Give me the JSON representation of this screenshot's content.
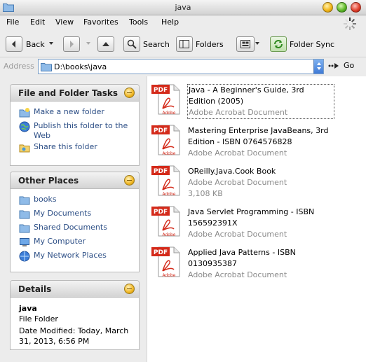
{
  "window": {
    "title": "java"
  },
  "menu": [
    "File",
    "Edit",
    "View",
    "Favorites",
    "Tools",
    "Help"
  ],
  "toolbar": {
    "back_label": "Back",
    "search_label": "Search",
    "folders_label": "Folders",
    "folder_sync_label": "Folder Sync"
  },
  "address": {
    "label": "Address",
    "value": "D:\\books\\java",
    "go_label": "Go"
  },
  "sidebar": {
    "tasks": {
      "title": "File and Folder Tasks",
      "items": [
        {
          "label": "Make a new folder",
          "icon": "new-folder-icon"
        },
        {
          "label": "Publish this folder to the Web",
          "icon": "globe-icon"
        },
        {
          "label": "Share this folder",
          "icon": "share-folder-icon"
        }
      ]
    },
    "places": {
      "title": "Other Places",
      "items": [
        {
          "label": "books",
          "icon": "folder-icon"
        },
        {
          "label": "My Documents",
          "icon": "folder-icon"
        },
        {
          "label": "Shared Documents",
          "icon": "folder-icon"
        },
        {
          "label": "My Computer",
          "icon": "computer-icon"
        },
        {
          "label": "My Network Places",
          "icon": "network-icon"
        }
      ]
    },
    "details": {
      "title": "Details",
      "name": "java",
      "type": "File Folder",
      "date": "Date Modified: Today, March 31, 2013, 6:56 PM"
    }
  },
  "files": [
    {
      "name": "Java - A Beginner's Guide, 3rd Edition (2005)",
      "type": "Adobe Acrobat Document",
      "size": "",
      "selected": true
    },
    {
      "name": "Mastering Enterprise JavaBeans, 3rd Edition - ISBN 0764576828",
      "type": "Adobe Acrobat Document",
      "size": ""
    },
    {
      "name": "OReilly.Java.Cook Book",
      "type": "Adobe Acrobat Document",
      "size": "3,108 KB"
    },
    {
      "name": "Java Servlet Programming - ISBN 156592391X",
      "type": "Adobe Acrobat Document",
      "size": ""
    },
    {
      "name": "Applied Java Patterns - ISBN 0130935387",
      "type": "Adobe Acrobat Document",
      "size": ""
    }
  ],
  "colors": {
    "link": "#2d4f86",
    "pdf_red": "#d42a1a",
    "muted": "#8a8a8a"
  }
}
